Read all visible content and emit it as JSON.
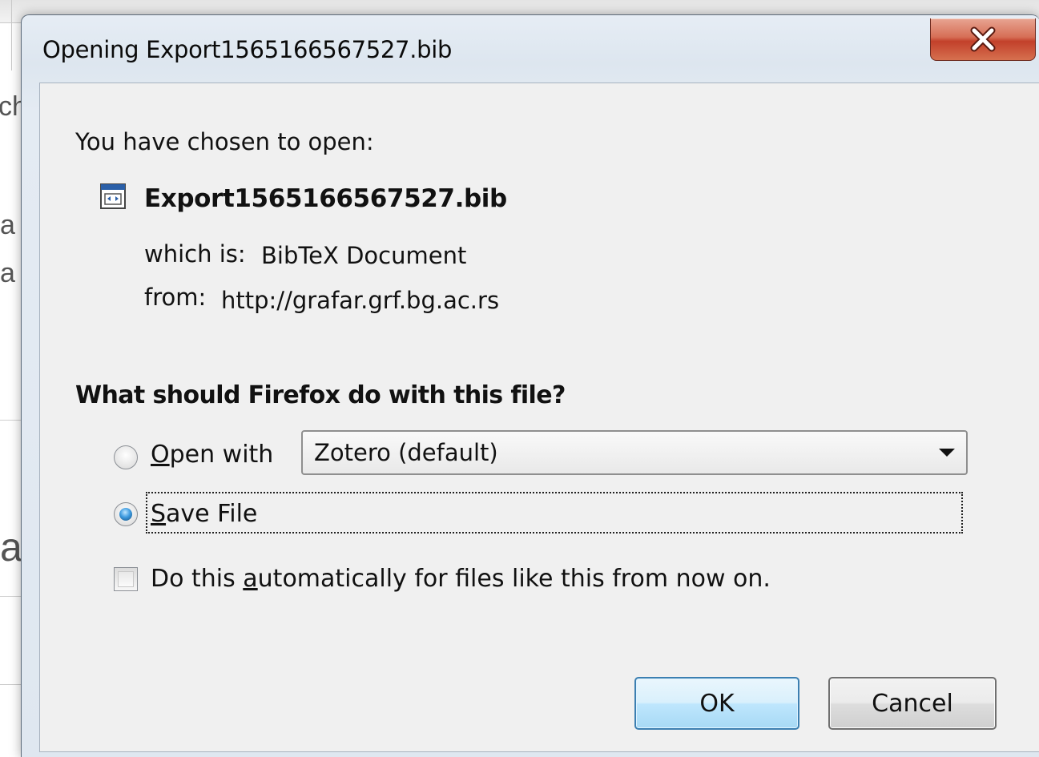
{
  "background_fragments": {
    "frag_1": "ch",
    "frag_2": "a",
    "frag_3": "a",
    "frag_4": "a"
  },
  "dialog": {
    "title": "Opening Export1565166567527.bib",
    "chosen_label": "You have chosen to open:",
    "file": {
      "name": "Export1565166567527.bib",
      "icon": "bib-file-icon",
      "which_is_label": "which is:",
      "which_is_value": "BibTeX Document",
      "from_label": "from:",
      "from_value": "http://grafar.grf.bg.ac.rs"
    },
    "question": "What should Firefox do with this file?",
    "options": {
      "open_with": {
        "label_accel": "O",
        "label_rest": "pen with",
        "selected": false,
        "app": "Zotero (default)"
      },
      "save_file": {
        "label_accel": "S",
        "label_rest": "ave File",
        "selected": true
      }
    },
    "auto": {
      "label_pre": "Do this ",
      "label_accel": "a",
      "label_post": "utomatically for files like this from now on.",
      "checked": false
    },
    "buttons": {
      "ok": "OK",
      "cancel": "Cancel"
    }
  },
  "colors": {
    "close_button": "#c2402a",
    "ok_border": "#3c7fb1",
    "radio_checked": "#3e9be0"
  }
}
